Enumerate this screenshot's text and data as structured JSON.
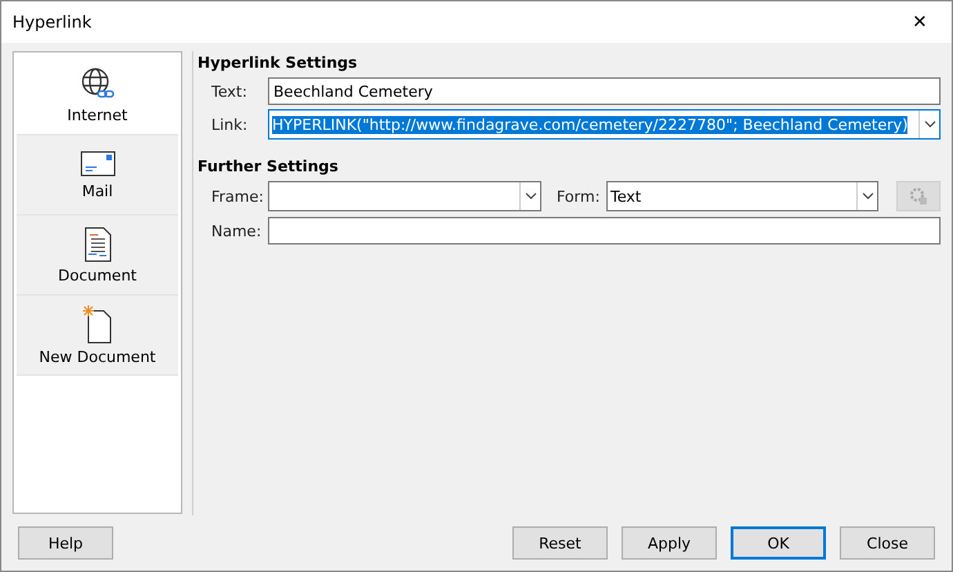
{
  "window": {
    "title": "Hyperlink",
    "close": "✕"
  },
  "sidebar": {
    "items": [
      {
        "label": "Internet",
        "kind": "internet",
        "selected": true
      },
      {
        "label": "Mail",
        "kind": "mail",
        "selected": false
      },
      {
        "label": "Document",
        "kind": "document",
        "selected": false
      },
      {
        "label": "New Document",
        "kind": "new",
        "selected": false
      }
    ]
  },
  "hyperlink_settings": {
    "heading": "Hyperlink Settings",
    "text": {
      "label": "Text:",
      "value": "Beechland Cemetery"
    },
    "link": {
      "label": "Link:",
      "value": "HYPERLINK(\"http://www.findagrave.com/cemetery/2227780\"; Beechland Cemetery)",
      "text_selected": true
    }
  },
  "further_settings": {
    "heading": "Further Settings",
    "frame": {
      "label": "Frame:"
    },
    "form": {
      "label": "Form:",
      "value": "Text"
    },
    "events_button": {
      "disabled": true
    },
    "name": {
      "label": "Name:"
    }
  },
  "buttons": [
    {
      "label": "Help",
      "default": false
    },
    {
      "label": "Reset",
      "default": false
    },
    {
      "label": "Apply",
      "default": false
    },
    {
      "label": "OK",
      "default": true
    },
    {
      "label": "Close",
      "default": false
    }
  ]
}
